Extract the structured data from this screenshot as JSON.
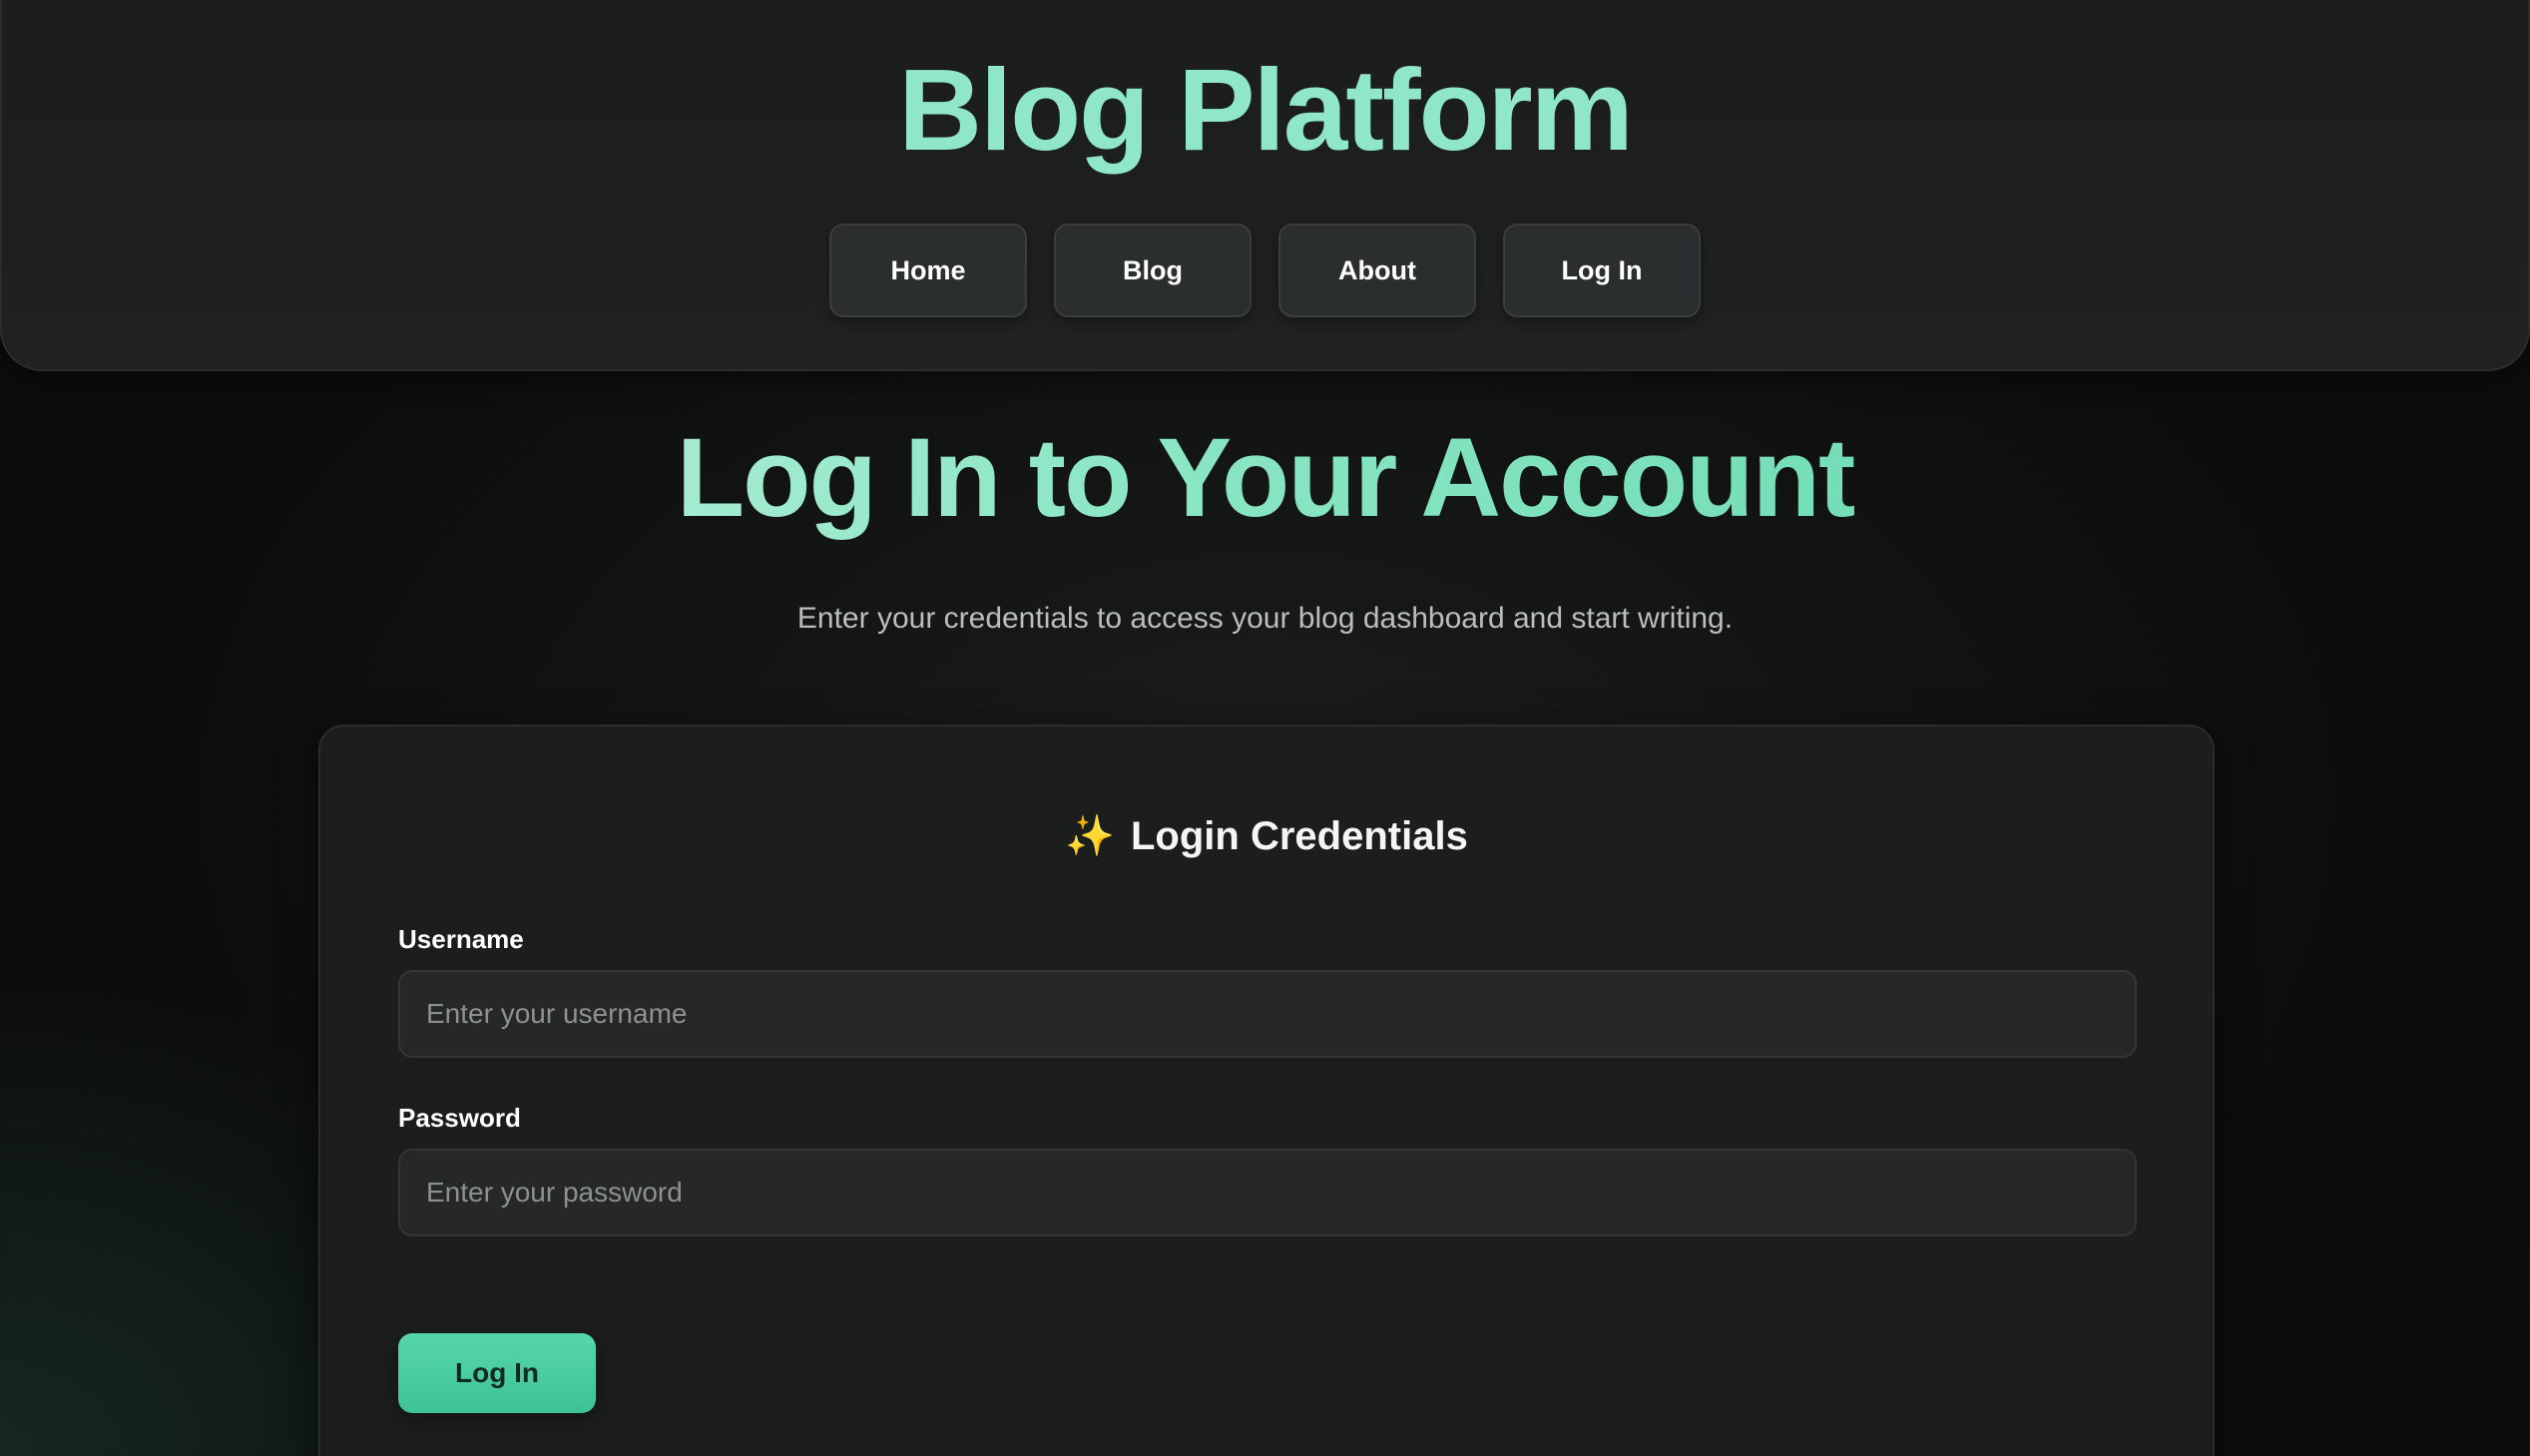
{
  "header": {
    "title": "Blog Platform",
    "nav": [
      {
        "label": "Home"
      },
      {
        "label": "Blog"
      },
      {
        "label": "About"
      },
      {
        "label": "Log In"
      }
    ]
  },
  "hero": {
    "heading": "Log In to Your Account",
    "subtitle": "Enter your credentials to access your blog dashboard and start writing."
  },
  "card": {
    "icon": "sparkles-icon",
    "icon_glyph": "✨",
    "title": "Login Credentials",
    "username": {
      "label": "Username",
      "value": "",
      "placeholder": "Enter your username"
    },
    "password": {
      "label": "Password",
      "value": "",
      "placeholder": "Enter your password"
    },
    "submit_label": "Log In"
  },
  "colors": {
    "accent": "#8fe6c9",
    "button_gradient_start": "#55d6ab",
    "button_gradient_end": "#3ec394",
    "sparkle": "#f2b04a",
    "background": "#0e0f0f",
    "card": "#1c1d1d"
  }
}
